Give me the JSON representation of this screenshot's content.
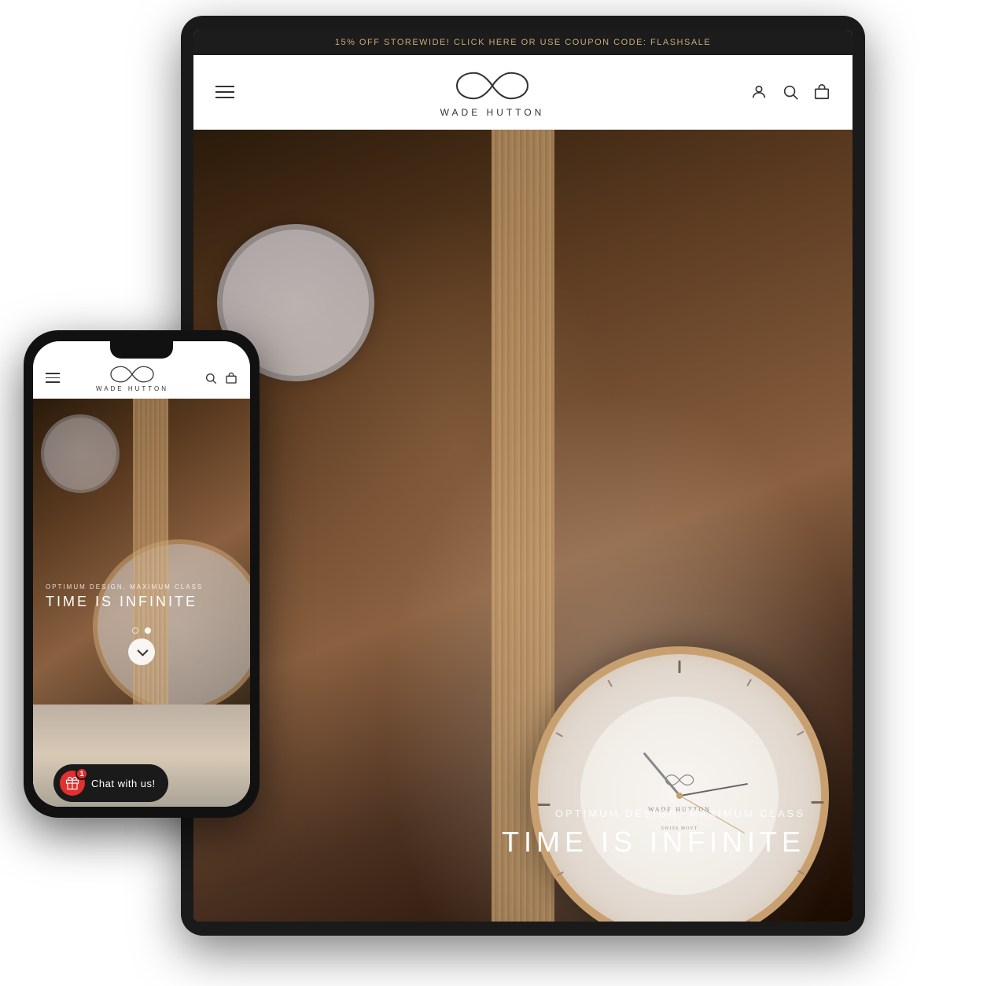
{
  "brand": {
    "name": "WADE HUTTON",
    "logo_alt": "Infinity symbol logo"
  },
  "promo_bar": {
    "text": "15% OFF STOREWIDE! CLICK HERE OR USE COUPON CODE: FLASHSALE"
  },
  "hero": {
    "subtitle": "OPTIMUM DESIGN, MAXIMUM CLASS",
    "title": "TIME IS INFINITE"
  },
  "phone_hero": {
    "subtitle": "OPTIMUM DESIGN, MAXIMUM CLASS",
    "title": "TIME IS INFINITE"
  },
  "nav": {
    "hamburger_label": "Menu",
    "search_label": "Search",
    "account_label": "Account",
    "cart_label": "Cart"
  },
  "carousel": {
    "dot1_label": "Slide 1",
    "dot2_label": "Slide 2"
  },
  "chat_widget": {
    "label": "Chat with us!",
    "badge": "1"
  },
  "colors": {
    "promo_bg": "#1c1c1c",
    "promo_text": "#c8a97a",
    "accent": "#c8a070",
    "chat_bg": "#1a1a1a",
    "badge_bg": "#e03030"
  }
}
